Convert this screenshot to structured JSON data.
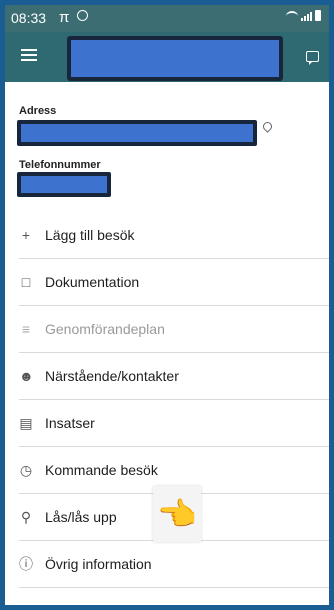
{
  "status": {
    "time": "08:33",
    "pi": "π"
  },
  "info": {
    "address_label": "Adress",
    "phone_label": "Telefonnummer"
  },
  "menu_items": [
    {
      "icon": "plus-icon",
      "label": "Lägg till besök"
    },
    {
      "icon": "document-icon",
      "label": "Dokumentation"
    },
    {
      "icon": "list-icon",
      "label": "Genomförandeplan"
    },
    {
      "icon": "contacts-icon",
      "label": "Närstående/kontakter"
    },
    {
      "icon": "clipboard-icon",
      "label": "Insatser"
    },
    {
      "icon": "clock-icon",
      "label": "Kommande besök"
    },
    {
      "icon": "key-icon",
      "label": "Lås/lås upp"
    },
    {
      "icon": "info-icon",
      "label": "Övrig information"
    }
  ],
  "colors": {
    "appbar": "#2f6a72",
    "redaction": "#3d72cf",
    "frame": "#1a5d92"
  },
  "icons": {
    "menu": "hamburger-icon",
    "chat": "chat-icon",
    "pin": "location-pin-icon",
    "hand": "pointing-hand-icon"
  }
}
